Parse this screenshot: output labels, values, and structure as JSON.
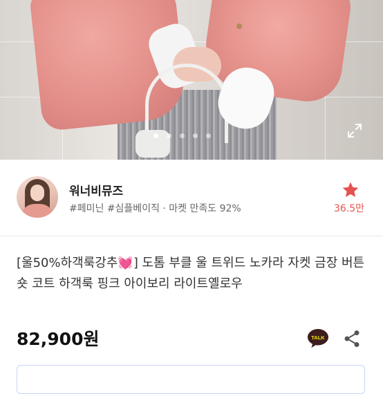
{
  "gallery": {
    "image_count": 5,
    "active_index": 0,
    "expand_icon": "expand-icon"
  },
  "seller": {
    "name": "워너비뮤즈",
    "tags": "#페미닌 #심플베이직 · 마켓 만족도 92%",
    "likes": "36.5만",
    "star_color": "#e6524f"
  },
  "product": {
    "title_prefix": "[울50%하객룩강추",
    "title_heart": "💓",
    "title_suffix": "] 도톰 부클 울 트위드 노카라 자켓 금장 버튼 숏 코트 하객룩 핑크 아이보리 라이트옐로우",
    "price": "82,900원"
  },
  "actions": {
    "talk_label": "TALK",
    "share_icon": "share-icon"
  },
  "info_box": {
    "text": "",
    "border_color": "#c8d3f7"
  }
}
